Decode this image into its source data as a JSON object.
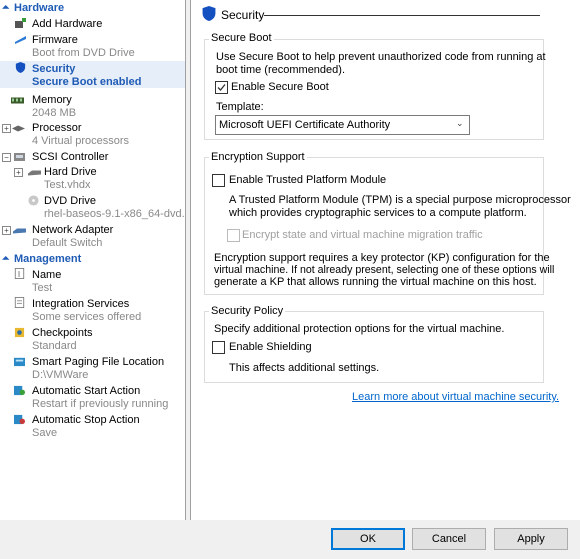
{
  "sidebar": {
    "hardware_label": "Hardware",
    "management_label": "Management",
    "items": [
      {
        "title": "Add Hardware",
        "sub": ""
      },
      {
        "title": "Firmware",
        "sub": "Boot from DVD Drive"
      },
      {
        "title": "Security",
        "sub": "Secure Boot enabled"
      },
      {
        "title": "Memory",
        "sub": "2048 MB"
      },
      {
        "title": "Processor",
        "sub": "4 Virtual processors"
      },
      {
        "title": "SCSI Controller",
        "sub": ""
      },
      {
        "title": "Hard Drive",
        "sub": "Test.vhdx"
      },
      {
        "title": "DVD Drive",
        "sub": "rhel-baseos-9.1-x86_64-dvd..."
      },
      {
        "title": "Network Adapter",
        "sub": "Default Switch"
      },
      {
        "title": "Name",
        "sub": "Test"
      },
      {
        "title": "Integration Services",
        "sub": "Some services offered"
      },
      {
        "title": "Checkpoints",
        "sub": "Standard"
      },
      {
        "title": "Smart Paging File Location",
        "sub": "D:\\VMWare"
      },
      {
        "title": "Automatic Start Action",
        "sub": "Restart if previously running"
      },
      {
        "title": "Automatic Stop Action",
        "sub": "Save"
      }
    ]
  },
  "main": {
    "header": "Security",
    "secure_boot": {
      "label": "Secure Boot",
      "desc1": "Use Secure Boot to help prevent unauthorized code from running at",
      "desc2": "boot time (recommended).",
      "enable_label": "Enable Secure Boot",
      "enable_checked": true,
      "template_label": "Template:",
      "template_value": "Microsoft UEFI Certificate Authority"
    },
    "encryption": {
      "label": "Encryption Support",
      "tpm_label": "Enable Trusted Platform Module",
      "tpm_checked": false,
      "tpm_desc1": "A Trusted Platform Module (TPM) is a special purpose microprocessor",
      "tpm_desc2": "which provides cryptographic services to a compute platform.",
      "encrypt_label": "Encrypt state and virtual machine migration traffic",
      "encrypt_checked": false,
      "kp1": "Encryption support requires a key protector (KP) configuration for the",
      "kp2": "virtual machine. If not already present, selecting one of these options will",
      "kp3": "generate a KP that allows running the virtual machine on this host."
    },
    "policy": {
      "label": "Security Policy",
      "desc": "Specify additional protection options for the virtual machine.",
      "shield_label": "Enable Shielding",
      "shield_checked": false,
      "shield_note": "This affects additional settings."
    },
    "learn_more": "Learn more about virtual machine security."
  },
  "footer": {
    "ok": "OK",
    "cancel": "Cancel",
    "apply": "Apply"
  },
  "colors": {
    "accent": "#1f5bb5",
    "selection": "#e6eef9",
    "link": "#0066cc"
  }
}
